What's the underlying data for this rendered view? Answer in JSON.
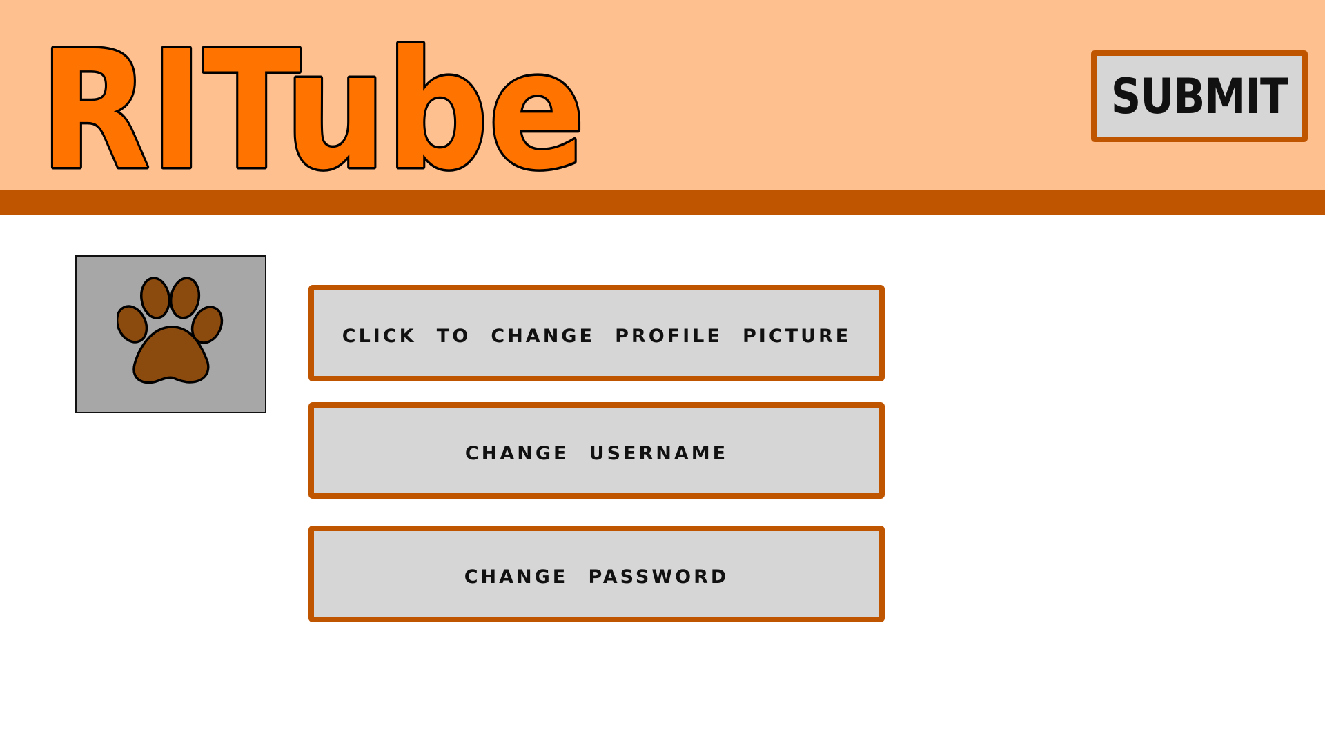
{
  "app": {
    "logo_text": "RITube"
  },
  "header": {
    "submit_label": "SUBMIT"
  },
  "profile": {
    "avatar_icon": "paw-icon"
  },
  "actions": {
    "change_picture_label": "CLICK TO CHANGE PROFILE PICTURE",
    "change_username_label": "CHANGE USERNAME",
    "change_password_label": "CHANGE PASSWORD"
  },
  "colors": {
    "header_background": "#fec08f",
    "accent": "#c05500",
    "logo_fill": "#ff7300",
    "button_background": "#d6d6d6",
    "avatar_background": "#a7a7a7",
    "paw_fill": "#8b4a0e"
  }
}
